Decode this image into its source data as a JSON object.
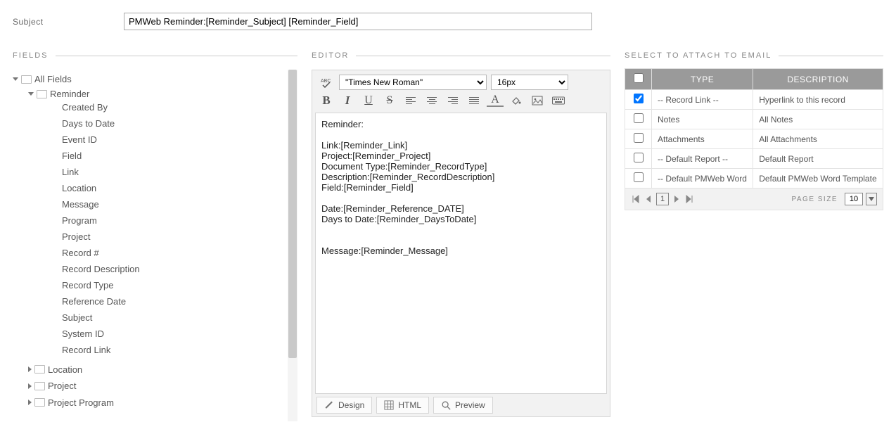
{
  "subject": {
    "label": "Subject",
    "value": "PMWeb Reminder:[Reminder_Subject] [Reminder_Field]"
  },
  "fields_section_title": "FIELDS",
  "editor_section_title": "EDITOR",
  "attach_section_title": "SELECT TO ATTACH TO EMAIL",
  "tree": {
    "root": "All Fields",
    "folders": [
      {
        "name": "Reminder",
        "expanded": true,
        "fields": [
          "Created By",
          "Days to Date",
          "Event ID",
          "Field",
          "Link",
          "Location",
          "Message",
          "Program",
          "Project",
          "Record #",
          "Record Description",
          "Record Type",
          "Reference Date",
          "Subject",
          "System ID",
          "Record Link"
        ]
      },
      {
        "name": "Location",
        "expanded": false
      },
      {
        "name": "Project",
        "expanded": false
      },
      {
        "name": "Project Program",
        "expanded": false
      }
    ]
  },
  "editor": {
    "font": "\"Times New Roman\"",
    "size": "16px",
    "body": "Reminder:\n\nLink:[Reminder_Link]\nProject:[Reminder_Project]\nDocument Type:[Reminder_RecordType]\nDescription:[Reminder_RecordDescription]\nField:[Reminder_Field]\n\nDate:[Reminder_Reference_DATE]\nDays to Date:[Reminder_DaysToDate]\n\n\nMessage:[Reminder_Message]",
    "tabs": {
      "design": "Design",
      "html": "HTML",
      "preview": "Preview"
    }
  },
  "attach": {
    "headers": {
      "type": "TYPE",
      "description": "DESCRIPTION"
    },
    "rows": [
      {
        "checked": true,
        "type": "-- Record Link --",
        "desc": "Hyperlink to this record"
      },
      {
        "checked": false,
        "type": "Notes",
        "desc": "All Notes"
      },
      {
        "checked": false,
        "type": "Attachments",
        "desc": "All Attachments"
      },
      {
        "checked": false,
        "type": "-- Default Report --",
        "desc": "Default Report"
      },
      {
        "checked": false,
        "type": "-- Default PMWeb Word",
        "desc": "Default PMWeb Word Template"
      }
    ],
    "pager": {
      "page": "1",
      "size_label": "PAGE SIZE",
      "size": "10"
    }
  }
}
